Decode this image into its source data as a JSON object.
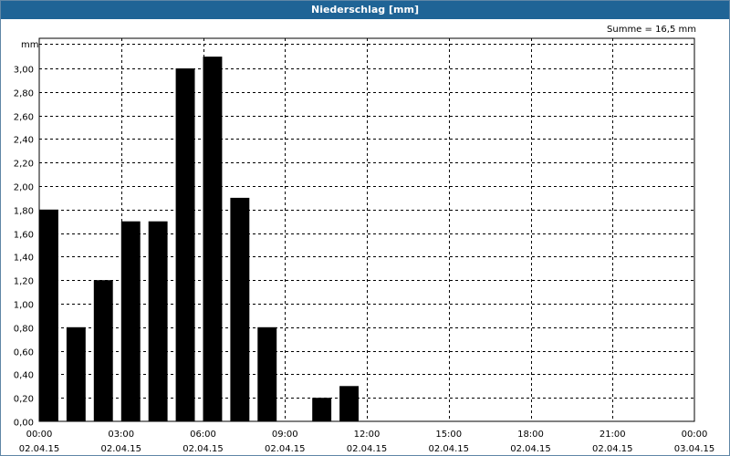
{
  "title": "Niederschlag [mm]",
  "summary": "Summe = 16,5 mm",
  "chart_data": {
    "type": "bar",
    "title": "Niederschlag [mm]",
    "ylabel": "mm",
    "ylim": [
      0,
      3.2
    ],
    "yticks": [
      "0,00",
      "0,20",
      "0,40",
      "0,60",
      "0,80",
      "1,00",
      "1,20",
      "1,40",
      "1,60",
      "1,80",
      "2,00",
      "2,20",
      "2,40",
      "2,60",
      "2,80",
      "3,00"
    ],
    "xticks": [
      {
        "time": "00:00",
        "date": "02.04.15"
      },
      {
        "time": "03:00",
        "date": "02.04.15"
      },
      {
        "time": "06:00",
        "date": "02.04.15"
      },
      {
        "time": "09:00",
        "date": "02.04.15"
      },
      {
        "time": "12:00",
        "date": "02.04.15"
      },
      {
        "time": "15:00",
        "date": "02.04.15"
      },
      {
        "time": "18:00",
        "date": "02.04.15"
      },
      {
        "time": "21:00",
        "date": "02.04.15"
      },
      {
        "time": "00:00",
        "date": "03.04.15"
      }
    ],
    "x_hours_start": [
      0,
      1,
      2,
      3,
      4,
      5,
      6,
      7,
      8,
      9,
      10,
      11,
      12,
      13,
      14,
      15,
      16,
      17,
      18,
      19,
      20,
      21,
      22,
      23
    ],
    "values": [
      1.8,
      0.8,
      1.2,
      1.7,
      1.7,
      3.0,
      3.1,
      1.9,
      0.8,
      0.0,
      0.2,
      0.3,
      0,
      0,
      0,
      0,
      0,
      0,
      0,
      0,
      0,
      0,
      0,
      0
    ],
    "grid": true,
    "bar_color": "#000000"
  }
}
